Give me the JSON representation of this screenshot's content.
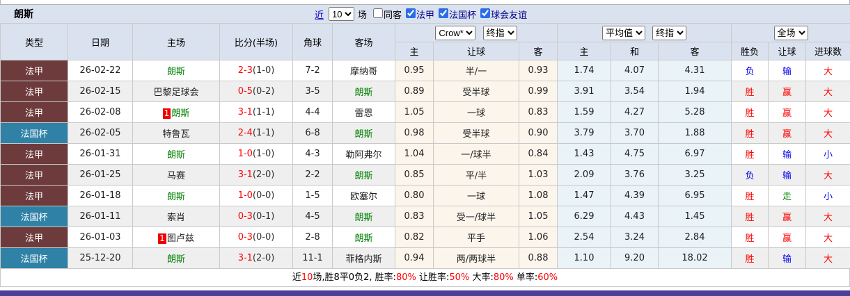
{
  "page": {
    "title": "朗斯"
  },
  "colors": {
    "header_bg": "#dbe2ef",
    "ligue1_bg": "#6e3b3d",
    "cup_bg": "#2f81a6",
    "crow_col_bg": "#fbf5ec",
    "avg_col_bg": "#e9f3f8",
    "row_alt_bg": "#efefef",
    "win_red": "#ff0000",
    "lose_blue": "#0000ee",
    "team_green": "#008000",
    "bottom_bar": "#4c3f99"
  },
  "toolbar": {
    "recent_label": "近",
    "recent_count": "10",
    "matches_label": "场",
    "filters": [
      {
        "label": "同客",
        "checked": false,
        "navy": false
      },
      {
        "label": "法甲",
        "checked": true,
        "navy": true
      },
      {
        "label": "法国杯",
        "checked": true,
        "navy": true
      },
      {
        "label": "球会友谊",
        "checked": true,
        "navy": true
      }
    ]
  },
  "table": {
    "left_headers": [
      "类型",
      "日期",
      "主场",
      "比分(半场)",
      "角球",
      "客场"
    ],
    "selects": {
      "bookmaker": "Crow*",
      "final1": "终指",
      "average": "平均值",
      "final2": "终指",
      "scope": "全场"
    },
    "sub_headers": [
      "主",
      "让球",
      "客",
      "主",
      "和",
      "客",
      "胜负",
      "让球",
      "进球数"
    ],
    "rows": [
      {
        "league": "法甲",
        "league_style": "maroon",
        "date": "26-02-22",
        "home": {
          "name": "朗斯",
          "green": true,
          "badge": ""
        },
        "score": "2-3",
        "half": "(1-0)",
        "corners": "7-2",
        "away": {
          "name": "摩纳哥",
          "green": false
        },
        "odds": {
          "home": "0.95",
          "handicap": "半/一",
          "away": "0.93"
        },
        "avg": {
          "home": "1.74",
          "draw": "4.07",
          "away": "4.31"
        },
        "result": {
          "wl": "负",
          "wl_c": "blue",
          "hc": "输",
          "hc_c": "blue",
          "goal": "大",
          "goal_c": "red"
        }
      },
      {
        "league": "法甲",
        "league_style": "maroon",
        "date": "26-02-15",
        "home": {
          "name": "巴黎足球会",
          "green": false,
          "badge": ""
        },
        "score": "0-5",
        "half": "(0-2)",
        "corners": "3-5",
        "away": {
          "name": "朗斯",
          "green": true
        },
        "odds": {
          "home": "0.89",
          "handicap": "受半球",
          "away": "0.99"
        },
        "avg": {
          "home": "3.91",
          "draw": "3.54",
          "away": "1.94"
        },
        "result": {
          "wl": "胜",
          "wl_c": "red",
          "hc": "赢",
          "hc_c": "red",
          "goal": "大",
          "goal_c": "red"
        }
      },
      {
        "league": "法甲",
        "league_style": "maroon",
        "date": "26-02-08",
        "home": {
          "name": "朗斯",
          "green": true,
          "badge": "1"
        },
        "score": "3-1",
        "half": "(1-1)",
        "corners": "4-4",
        "away": {
          "name": "雷恩",
          "green": false
        },
        "odds": {
          "home": "1.05",
          "handicap": "一球",
          "away": "0.83"
        },
        "avg": {
          "home": "1.59",
          "draw": "4.27",
          "away": "5.28"
        },
        "result": {
          "wl": "胜",
          "wl_c": "red",
          "hc": "赢",
          "hc_c": "red",
          "goal": "大",
          "goal_c": "red"
        }
      },
      {
        "league": "法国杯",
        "league_style": "teal",
        "date": "26-02-05",
        "home": {
          "name": "特鲁瓦",
          "green": false,
          "badge": ""
        },
        "score": "2-4",
        "half": "(1-1)",
        "corners": "6-8",
        "away": {
          "name": "朗斯",
          "green": true
        },
        "odds": {
          "home": "0.98",
          "handicap": "受半球",
          "away": "0.90"
        },
        "avg": {
          "home": "3.79",
          "draw": "3.70",
          "away": "1.88"
        },
        "result": {
          "wl": "胜",
          "wl_c": "red",
          "hc": "赢",
          "hc_c": "red",
          "goal": "大",
          "goal_c": "red"
        }
      },
      {
        "league": "法甲",
        "league_style": "maroon",
        "date": "26-01-31",
        "home": {
          "name": "朗斯",
          "green": true,
          "badge": ""
        },
        "score": "1-0",
        "half": "(1-0)",
        "corners": "4-3",
        "away": {
          "name": "勒阿弗尔",
          "green": false
        },
        "odds": {
          "home": "1.04",
          "handicap": "一/球半",
          "away": "0.84"
        },
        "avg": {
          "home": "1.43",
          "draw": "4.75",
          "away": "6.97"
        },
        "result": {
          "wl": "胜",
          "wl_c": "red",
          "hc": "输",
          "hc_c": "blue",
          "goal": "小",
          "goal_c": "blue"
        }
      },
      {
        "league": "法甲",
        "league_style": "maroon",
        "date": "26-01-25",
        "home": {
          "name": "马赛",
          "green": false,
          "badge": ""
        },
        "score": "3-1",
        "half": "(2-0)",
        "corners": "2-2",
        "away": {
          "name": "朗斯",
          "green": true
        },
        "odds": {
          "home": "0.85",
          "handicap": "平/半",
          "away": "1.03"
        },
        "avg": {
          "home": "2.09",
          "draw": "3.76",
          "away": "3.25"
        },
        "result": {
          "wl": "负",
          "wl_c": "blue",
          "hc": "输",
          "hc_c": "blue",
          "goal": "大",
          "goal_c": "red"
        }
      },
      {
        "league": "法甲",
        "league_style": "maroon",
        "date": "26-01-18",
        "home": {
          "name": "朗斯",
          "green": true,
          "badge": ""
        },
        "score": "1-0",
        "half": "(0-0)",
        "corners": "1-5",
        "away": {
          "name": "欧塞尔",
          "green": false
        },
        "odds": {
          "home": "0.80",
          "handicap": "一球",
          "away": "1.08"
        },
        "avg": {
          "home": "1.47",
          "draw": "4.39",
          "away": "6.95"
        },
        "result": {
          "wl": "胜",
          "wl_c": "red",
          "hc": "走",
          "hc_c": "green",
          "goal": "小",
          "goal_c": "blue"
        }
      },
      {
        "league": "法国杯",
        "league_style": "teal",
        "date": "26-01-11",
        "home": {
          "name": "索肖",
          "green": false,
          "badge": ""
        },
        "score": "0-3",
        "half": "(0-1)",
        "corners": "4-5",
        "away": {
          "name": "朗斯",
          "green": true
        },
        "odds": {
          "home": "0.83",
          "handicap": "受一/球半",
          "away": "1.05"
        },
        "avg": {
          "home": "6.29",
          "draw": "4.43",
          "away": "1.45"
        },
        "result": {
          "wl": "胜",
          "wl_c": "red",
          "hc": "赢",
          "hc_c": "red",
          "goal": "大",
          "goal_c": "red"
        }
      },
      {
        "league": "法甲",
        "league_style": "maroon",
        "date": "26-01-03",
        "home": {
          "name": "图卢兹",
          "green": false,
          "badge": "1"
        },
        "score": "0-3",
        "half": "(0-0)",
        "corners": "2-8",
        "away": {
          "name": "朗斯",
          "green": true
        },
        "odds": {
          "home": "0.82",
          "handicap": "平手",
          "away": "1.06"
        },
        "avg": {
          "home": "2.54",
          "draw": "3.24",
          "away": "2.84"
        },
        "result": {
          "wl": "胜",
          "wl_c": "red",
          "hc": "赢",
          "hc_c": "red",
          "goal": "大",
          "goal_c": "red"
        }
      },
      {
        "league": "法国杯",
        "league_style": "teal",
        "date": "25-12-20",
        "home": {
          "name": "朗斯",
          "green": true,
          "badge": ""
        },
        "score": "3-1",
        "half": "(2-0)",
        "corners": "11-1",
        "away": {
          "name": "菲格内斯",
          "green": false
        },
        "odds": {
          "home": "0.94",
          "handicap": "两/两球半",
          "away": "0.88"
        },
        "avg": {
          "home": "1.10",
          "draw": "9.20",
          "away": "18.02"
        },
        "result": {
          "wl": "胜",
          "wl_c": "red",
          "hc": "输",
          "hc_c": "blue",
          "goal": "大",
          "goal_c": "red"
        }
      }
    ]
  },
  "footer": {
    "segments": [
      {
        "text": "近",
        "red": false
      },
      {
        "text": "10",
        "red": true
      },
      {
        "text": "场,胜8平0负2, 胜率:",
        "red": false
      },
      {
        "text": "80%",
        "red": true
      },
      {
        "text": " 让胜率:",
        "red": false
      },
      {
        "text": "50%",
        "red": true
      },
      {
        "text": " 大率:",
        "red": false
      },
      {
        "text": "80%",
        "red": true
      },
      {
        "text": " 单率:",
        "red": false
      },
      {
        "text": "60%",
        "red": true
      }
    ]
  }
}
